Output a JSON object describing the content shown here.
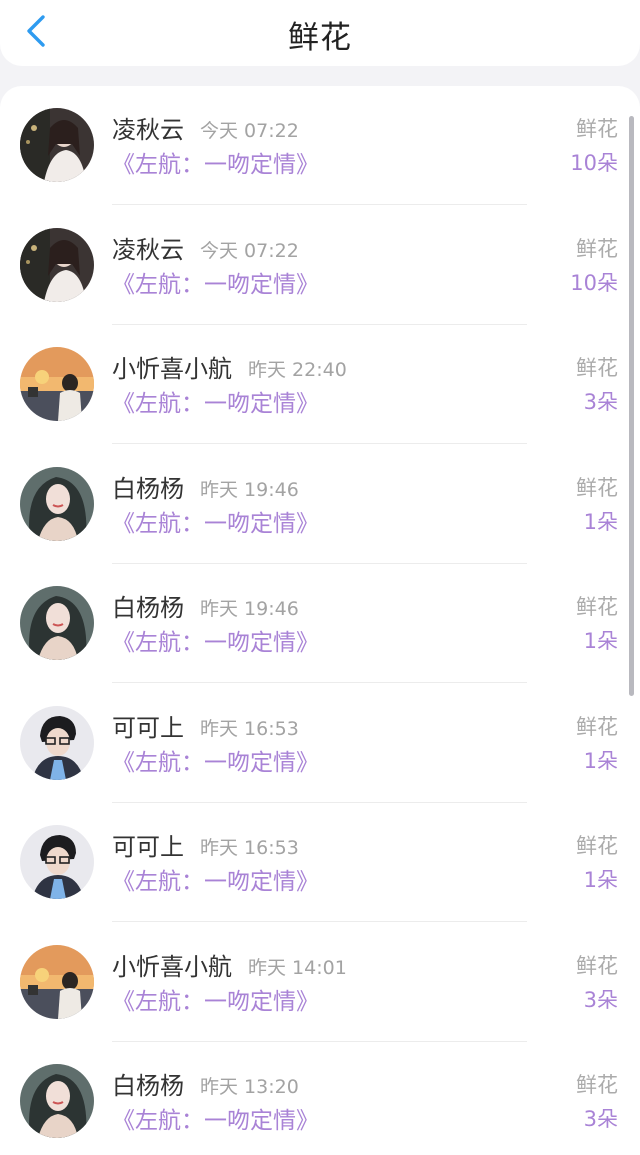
{
  "header": {
    "title": "鲜花",
    "back_icon": "chevron-left-icon",
    "accent": "#2e9bf0"
  },
  "colors": {
    "book": "#a983d6",
    "count": "#a983d6",
    "muted": "#a3a3a3"
  },
  "gifts": [
    {
      "name": "凌秋云",
      "time": "今天 07:22",
      "book": "《左航：一吻定情》",
      "type": "鲜花",
      "count": "10朵",
      "avatar": "avatar-a"
    },
    {
      "name": "凌秋云",
      "time": "今天 07:22",
      "book": "《左航：一吻定情》",
      "type": "鲜花",
      "count": "10朵",
      "avatar": "avatar-a"
    },
    {
      "name": "小忻喜小航",
      "time": "昨天 22:40",
      "book": "《左航：一吻定情》",
      "type": "鲜花",
      "count": "3朵",
      "avatar": "avatar-b"
    },
    {
      "name": "白杨杨",
      "time": "昨天 19:46",
      "book": "《左航：一吻定情》",
      "type": "鲜花",
      "count": "1朵",
      "avatar": "avatar-c"
    },
    {
      "name": "白杨杨",
      "time": "昨天 19:46",
      "book": "《左航：一吻定情》",
      "type": "鲜花",
      "count": "1朵",
      "avatar": "avatar-c"
    },
    {
      "name": "可可上",
      "time": "昨天 16:53",
      "book": "《左航：一吻定情》",
      "type": "鲜花",
      "count": "1朵",
      "avatar": "avatar-d"
    },
    {
      "name": "可可上",
      "time": "昨天 16:53",
      "book": "《左航：一吻定情》",
      "type": "鲜花",
      "count": "1朵",
      "avatar": "avatar-d"
    },
    {
      "name": "小忻喜小航",
      "time": "昨天 14:01",
      "book": "《左航：一吻定情》",
      "type": "鲜花",
      "count": "3朵",
      "avatar": "avatar-b"
    },
    {
      "name": "白杨杨",
      "time": "昨天 13:20",
      "book": "《左航：一吻定情》",
      "type": "鲜花",
      "count": "3朵",
      "avatar": "avatar-c"
    }
  ]
}
